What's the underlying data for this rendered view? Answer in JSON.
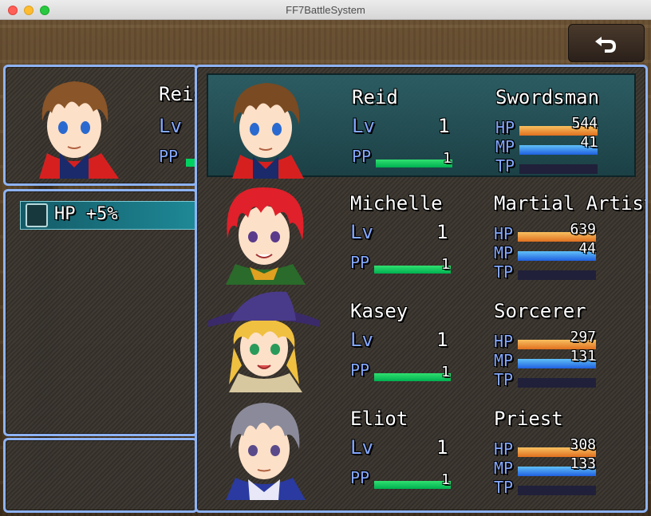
{
  "window": {
    "title": "FF7BattleSystem"
  },
  "status": {
    "name": "Reid",
    "lv_label": "Lv",
    "pp_label": "PP"
  },
  "skill": {
    "label": "HP +5%"
  },
  "labels": {
    "lv": "Lv",
    "pp": "PP",
    "hp": "HP",
    "mp": "MP",
    "tp": "TP"
  },
  "party": [
    {
      "name": "Reid",
      "class": "Swordsman",
      "level": "1",
      "pp": "1",
      "pp_fill": 1.0,
      "hp": "544",
      "hp_fill": 1.0,
      "mp": "41",
      "mp_fill": 1.0,
      "tp_fill": 0,
      "selected": true,
      "hair": "#7a4a22",
      "portrait": "reid"
    },
    {
      "name": "Michelle",
      "class": "Martial Artist",
      "level": "1",
      "pp": "1",
      "pp_fill": 1.0,
      "hp": "639",
      "hp_fill": 1.0,
      "mp": "44",
      "mp_fill": 1.0,
      "tp_fill": 0,
      "selected": false,
      "hair": "#e0202a",
      "portrait": "michelle"
    },
    {
      "name": "Kasey",
      "class": "Sorcerer",
      "level": "1",
      "pp": "1",
      "pp_fill": 1.0,
      "hp": "297",
      "hp_fill": 1.0,
      "mp": "131",
      "mp_fill": 1.0,
      "tp_fill": 0,
      "selected": false,
      "hair": "#f0c040",
      "portrait": "kasey"
    },
    {
      "name": "Eliot",
      "class": "Priest",
      "level": "1",
      "pp": "1",
      "pp_fill": 1.0,
      "hp": "308",
      "hp_fill": 1.0,
      "mp": "133",
      "mp_fill": 1.0,
      "tp_fill": 0,
      "selected": false,
      "hair": "#8a8a9a",
      "portrait": "eliot"
    }
  ],
  "colors": {
    "window_border": "#8eb3f5",
    "system_text": "#84a8ff",
    "pp_gauge": "#00d060",
    "hp_gauge": "#f8a040",
    "mp_gauge": "#40a0f0",
    "selected_row": "#2a6068"
  }
}
